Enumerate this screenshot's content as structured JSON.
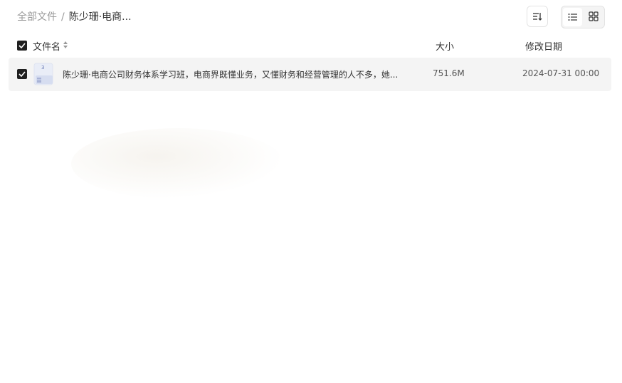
{
  "breadcrumb": {
    "root": "全部文件",
    "separator": "/",
    "current": "陈少珊·电商..."
  },
  "toolbar": {
    "sort_icon": "sort-icon",
    "list_view_icon": "list-view-icon",
    "grid_view_icon": "grid-view-icon",
    "active_view": "list"
  },
  "table": {
    "columns": {
      "name": "文件名",
      "size": "大小",
      "date": "修改日期"
    },
    "rows": [
      {
        "name": "陈少珊·电商公司财务体系学习班，电商界既懂业务，又懂财务和经营管理的人不多，她...",
        "size": "751.6M",
        "date": "2024-07-31 00:00",
        "checked": true,
        "icon": "archive-file-icon"
      }
    ]
  },
  "colors": {
    "accent_dark": "#1f1f1f",
    "row_bg": "#f4f4f4",
    "muted_text": "#9a9a9a"
  }
}
